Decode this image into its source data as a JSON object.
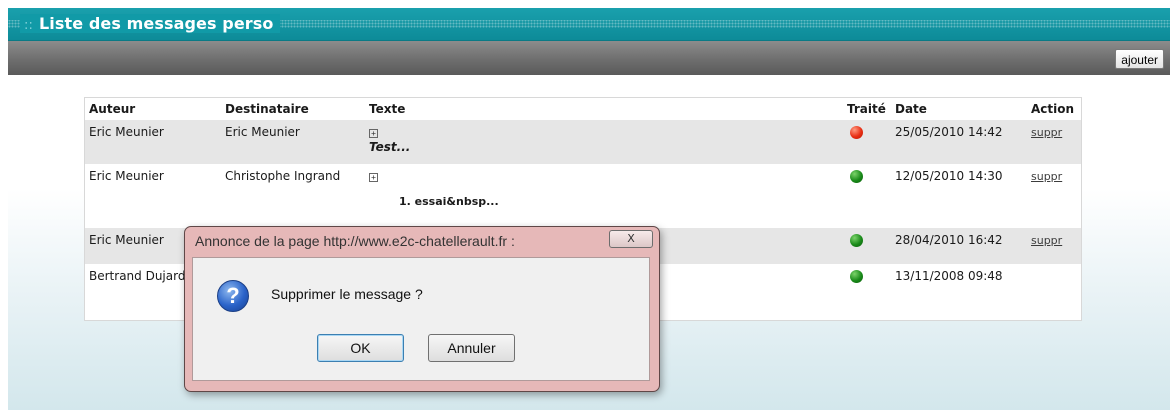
{
  "header": {
    "prefix": "::",
    "title": "Liste des messages perso"
  },
  "toolbar": {
    "add_label": "ajouter"
  },
  "table": {
    "columns": [
      "Auteur",
      "Destinataire",
      "Texte",
      "Traité",
      "Date",
      "Action"
    ],
    "rows": [
      {
        "author": "Eric Meunier",
        "recipient": "Eric Meunier",
        "expander": "+",
        "text": "Test...",
        "status": "red",
        "date": "25/05/2010 14:42",
        "action": "suppr"
      },
      {
        "author": "Eric Meunier",
        "recipient": "Christophe Ingrand",
        "expander": "+",
        "text": "1.  essai&nbsp...",
        "status": "green",
        "date": "12/05/2010 14:30",
        "action": "suppr"
      },
      {
        "author": "Eric Meunier",
        "recipient": "",
        "expander": "",
        "text": "",
        "status": "green",
        "date": "28/04/2010 16:42",
        "action": "suppr"
      },
      {
        "author": "Bertrand Dujard",
        "recipient": "",
        "expander": "",
        "text": "",
        "status": "green",
        "date": "13/11/2008 09:48",
        "action": ""
      }
    ]
  },
  "dialog": {
    "title": "Annonce de la page http://www.e2c-chatellerault.fr :",
    "close_label": "X",
    "icon": "question-icon",
    "message": "Supprimer le message ?",
    "ok_label": "OK",
    "cancel_label": "Annuler"
  },
  "colors": {
    "status_red": "#e82e14",
    "status_green": "#1a8a1a",
    "header_teal": "#119aa7"
  }
}
